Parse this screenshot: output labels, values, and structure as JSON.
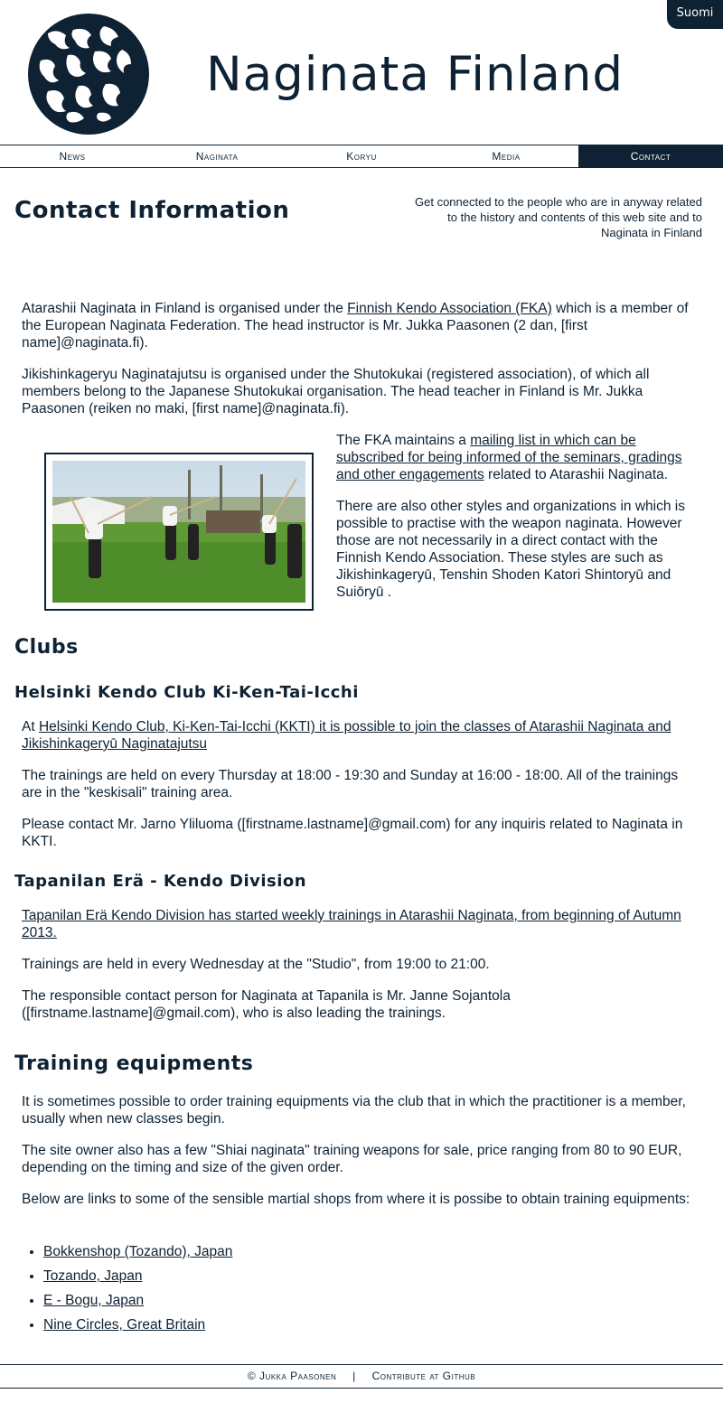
{
  "header": {
    "language_toggle": "Suomi",
    "site_title": "Naginata Finland",
    "logo_icon": "naginata-kanji-logo-icon"
  },
  "nav": {
    "items": [
      {
        "label": "News"
      },
      {
        "label": "Naginata"
      },
      {
        "label": "Koryu"
      },
      {
        "label": "Media"
      },
      {
        "label": "Contact"
      }
    ],
    "active": "Contact"
  },
  "main": {
    "title": "Contact Information",
    "intro": "Get connected to the people who are in anyway related to the history and contents of this web site and to Naginata in Finland",
    "p1_before": "Atarashii Naginata in Finland is organised under the ",
    "p1_link": "Finnish Kendo Association (FKA)",
    "p1_after": " which is a member of the European Naginata Federation. The head instructor is Mr. Jukka Paasonen (2 dan, [first name]@naginata.fi).",
    "p2": "Jikishinkageryu Naginatajutsu is organised under the Shutokukai (registered association), of which all members belong to the Japanese Shutokukai organisation. The head teacher in Finland is Mr. Jukka Paasonen (reiken no maki, [first name]@naginata.fi).",
    "p3_before": "The FKA maintains a ",
    "p3_link": "mailing list in which can be subscribed for being informed of the seminars, gradings and other engagements",
    "p3_after": " related to Atarashii Naginata.",
    "p4": "There are also other styles and organizations in which is possible to practise with the weapon naginata. However those are not necessarily in a direct contact with the Finnish Kendo Association. These styles are such as Jikishinkageryū, Tenshin Shoden Katori Shintoryū and Suiōryū ."
  },
  "clubs": {
    "heading": "Clubs",
    "kkti": {
      "heading": "Helsinki Kendo Club Ki-Ken-Tai-Icchi",
      "p1_before": "At ",
      "p1_link": "Helsinki Kendo Club, Ki-Ken-Tai-Icchi (KKTI) it is possible to join the classes of Atarashii Naginata and Jikishinkageryū Naginatajutsu",
      "p2": "The trainings are held on every Thursday at 18:00 - 19:30 and Sunday at 16:00 - 18:00. All of the trainings are in the \"keskisali\" training area.",
      "p3": "Please contact Mr. Jarno Yliluoma ([firstname.lastname]@gmail.com) for any inquiris related to Naginata in KKTI."
    },
    "tapanila": {
      "heading": "Tapanilan Erä - Kendo Division",
      "p1_link": "Tapanilan Erä Kendo Division has started weekly trainings in Atarashii Naginata, from beginning of Autumn 2013.",
      "p2": "Trainings are held in every Wednesday at the \"Studio\", from 19:00 to 21:00.",
      "p3": "The responsible contact person for Naginata at Tapanila is Mr. Janne Sojantola ([firstname.lastname]@gmail.com), who is also leading the trainings."
    }
  },
  "equipment": {
    "heading": "Training equipments",
    "p1": "It is sometimes possible to order training equipments via the club that in which the practitioner is a member, usually when new classes begin.",
    "p2": "The site owner also has a few \"Shiai naginata\" training weapons for sale, price ranging from 80 to 90 EUR, depending on the timing and size of the given order.",
    "p3": "Below are links to some of the sensible martial shops from where it is possibe to obtain training equipments:",
    "shops": [
      {
        "label": "Bokkenshop (Tozando), Japan"
      },
      {
        "label": "Tozando, Japan"
      },
      {
        "label": "E - Bogu, Japan"
      },
      {
        "label": "Nine Circles, Great Britain"
      }
    ]
  },
  "footer": {
    "copyright": "© Jukka Paasonen",
    "separator": "|",
    "github": "Contribute at Github"
  }
}
